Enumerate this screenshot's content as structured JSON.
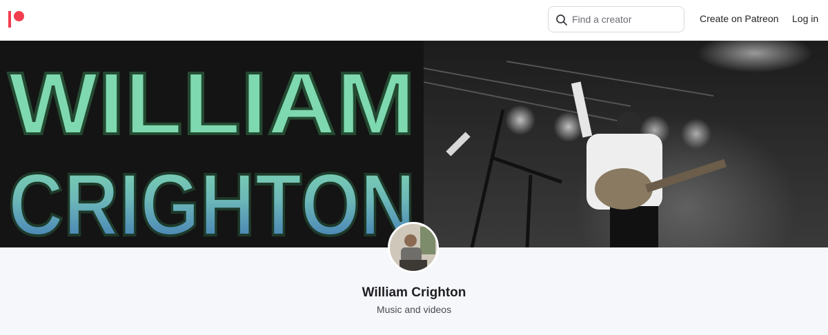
{
  "header": {
    "logo_icon": "patreon-logo-icon",
    "search": {
      "placeholder": "Find a creator",
      "value": "",
      "icon": "search-icon"
    },
    "create_label": "Create on Patreon",
    "login_label": "Log in"
  },
  "banner": {
    "line1": "WILLIAM",
    "line2": "CRIGHTON"
  },
  "profile": {
    "name": "William Crighton",
    "tagline": "Music and videos"
  },
  "colors": {
    "brand": "#f23d4f",
    "banner_text_top": "#7fd9b0",
    "banner_text_bottom": "#3b6fb5",
    "profile_bg": "#f6f7fb"
  }
}
